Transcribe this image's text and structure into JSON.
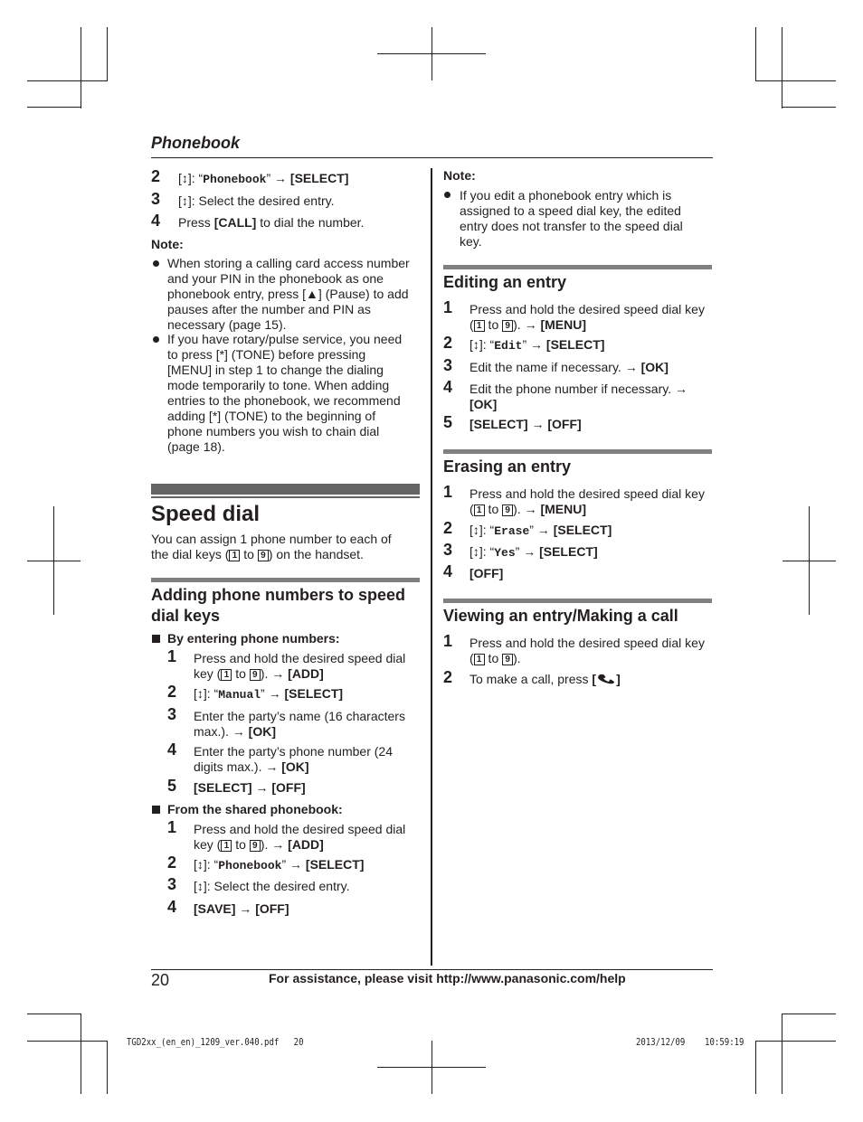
{
  "header": {
    "section": "Phonebook"
  },
  "left_column": {
    "phonebook_steps": [
      {
        "num": "2",
        "pre": "[↕]: “",
        "mono": "Phonebook",
        "post": "” → ",
        "key": "[SELECT]"
      },
      {
        "num": "3",
        "pre": "[↕]: Select the desired entry."
      },
      {
        "num": "4",
        "pre": "Press ",
        "key": "[CALL]",
        "post": " to dial the number."
      }
    ],
    "note_label": "Note:",
    "notes": [
      {
        "lines": [
          "When storing a calling card access number",
          "and your PIN in the phonebook as one",
          "phonebook entry, press [▲] (Pause) to add",
          "pauses after the number and PIN as",
          "necessary (page 15)."
        ]
      },
      {
        "lines": [
          "If you have rotary/pulse service, you need",
          "to press [*] (TONE) before pressing",
          "[MENU] in step 1 to change the dialing",
          "mode temporarily to tone. When adding",
          "entries to the phonebook, we recommend",
          "adding [*] (TONE) to the beginning of",
          "phone numbers you wish to chain dial",
          "(page 18)."
        ]
      }
    ],
    "speed_dial": {
      "title": "Speed dial",
      "intro_line1": "You can assign 1 phone number to each of",
      "intro_line2_pre": "the dial keys (",
      "key1": "1",
      "to": " to ",
      "key9": "9",
      "intro_line2_post": ") on the handset."
    },
    "adding": {
      "title_line1": "Adding phone numbers to speed",
      "title_line2": "dial keys",
      "by_entering": {
        "label": "By entering phone numbers:",
        "steps": [
          {
            "num": "1",
            "line1": "Press and hold the desired speed dial",
            "line2_pre": "key (",
            "line2_post": "). → ",
            "key": "[ADD]"
          },
          {
            "num": "2",
            "pre": "[↕]: “",
            "mono": "Manual",
            "post": "” → ",
            "key": "[SELECT]"
          },
          {
            "num": "3",
            "line1": "Enter the party’s name (16 characters",
            "line2_pre": "max.). → ",
            "key": "[OK]"
          },
          {
            "num": "4",
            "line1": "Enter the party’s phone number (24",
            "line2_pre": "digits max.). → ",
            "key": "[OK]"
          },
          {
            "num": "5",
            "key": "[SELECT]",
            "post": " → ",
            "key2": "[OFF]"
          }
        ]
      },
      "from_shared": {
        "label": "From the shared phonebook:",
        "steps": [
          {
            "num": "1",
            "line1": "Press and hold the desired speed dial",
            "line2_pre": "key (",
            "line2_post": "). → ",
            "key": "[ADD]"
          },
          {
            "num": "2",
            "pre": "[↕]: “",
            "mono": "Phonebook",
            "post": "” → ",
            "key": "[SELECT]"
          },
          {
            "num": "3",
            "pre": "[↕]: Select the desired entry."
          },
          {
            "num": "4",
            "key": "[SAVE]",
            "post": " → ",
            "key2": "[OFF]"
          }
        ]
      }
    }
  },
  "right_column": {
    "note_label": "Note:",
    "note_lines": [
      "If you edit a phonebook entry which is",
      "assigned to a speed dial key, the edited",
      "entry does not transfer to the speed dial",
      "key."
    ],
    "editing": {
      "title": "Editing an entry",
      "steps": [
        {
          "num": "1",
          "line1": "Press and hold the desired speed dial key",
          "line2_post": "). → ",
          "key": "[MENU]"
        },
        {
          "num": "2",
          "pre": "[↕]: “",
          "mono": "Edit",
          "post": "” → ",
          "key": "[SELECT]"
        },
        {
          "num": "3",
          "pre": "Edit the name if necessary. → ",
          "key": "[OK]"
        },
        {
          "num": "4",
          "pre": "Edit the phone number if necessary. →",
          "key": "[OK]"
        },
        {
          "num": "5",
          "key": "[SELECT]",
          "post": " → ",
          "key2": "[OFF]"
        }
      ]
    },
    "erasing": {
      "title": "Erasing an entry",
      "steps": [
        {
          "num": "1",
          "line1": "Press and hold the desired speed dial key",
          "line2_post": "). → ",
          "key": "[MENU]"
        },
        {
          "num": "2",
          "pre": "[↕]: “",
          "mono": "Erase",
          "post": "” → ",
          "key": "[SELECT]"
        },
        {
          "num": "3",
          "pre": "[↕]: “",
          "mono": "Yes",
          "post": "” → ",
          "key": "[SELECT]"
        },
        {
          "num": "4",
          "key": "[OFF]"
        }
      ]
    },
    "viewing": {
      "title": "Viewing an entry/Making a call",
      "steps": [
        {
          "num": "1",
          "line1": "Press and hold the desired speed dial key",
          "line2_post": ")."
        },
        {
          "num": "2",
          "pre": "To make a call, press "
        }
      ]
    }
  },
  "footer": {
    "page_number": "20",
    "assistance": "For assistance, please visit http://www.panasonic.com/help",
    "slug_file": "TGD2xx_(en_en)_1209_ver.040.pdf",
    "slug_page": "20",
    "slug_date": "2013/12/09",
    "slug_time": "10:59:19"
  }
}
